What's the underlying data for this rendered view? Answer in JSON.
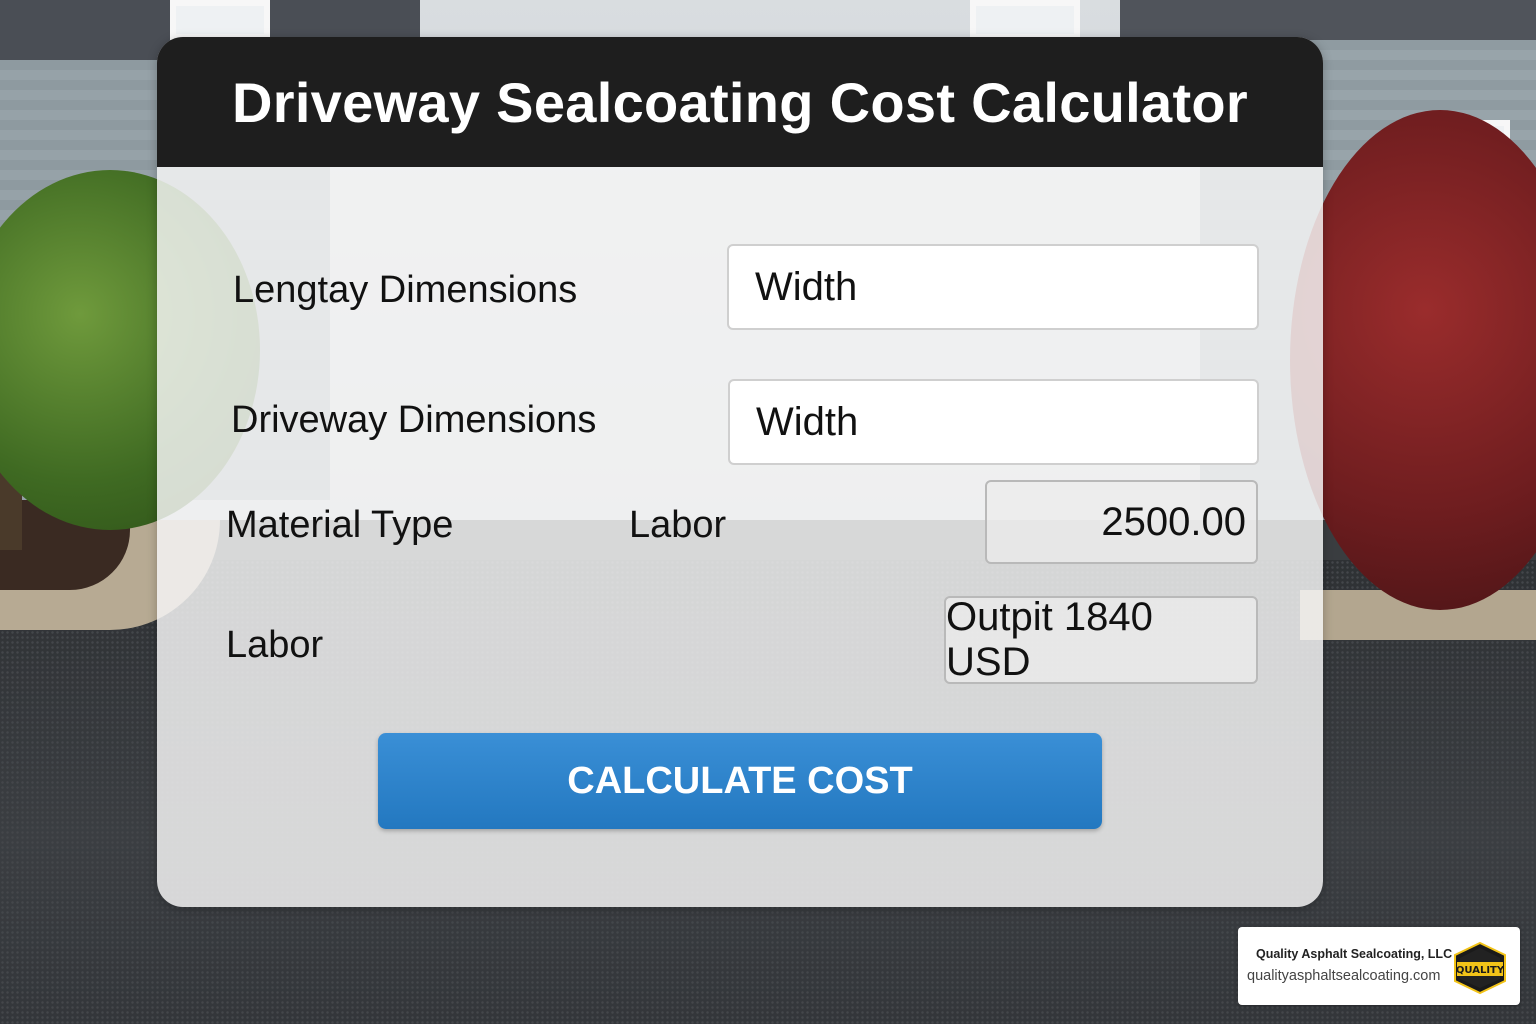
{
  "app": {
    "title": "Driveway Sealcoating Cost Calculator"
  },
  "form": {
    "row1": {
      "label": "Lengtay Dimensions",
      "input_value": "Width"
    },
    "row2": {
      "label": "Driveway Dimensions",
      "input_value": "Width"
    },
    "row3": {
      "label": "Material Type",
      "sub_label": "Labor",
      "value": "2500.00"
    },
    "row4": {
      "label": "Labor",
      "output": "Outpit 1840 USD"
    }
  },
  "actions": {
    "calculate_label": "CALCULATE COST"
  },
  "brand": {
    "company": "Quality Asphalt Sealcoating, LLC",
    "website": "qualityasphaltsealcoating.com",
    "logo_text": "QUALITY",
    "logo_icon": "quality-shield-logo"
  },
  "colors": {
    "header_bg": "#1e1e1e",
    "button_blue": "#2a80c8",
    "logo_yellow": "#f2c318"
  }
}
